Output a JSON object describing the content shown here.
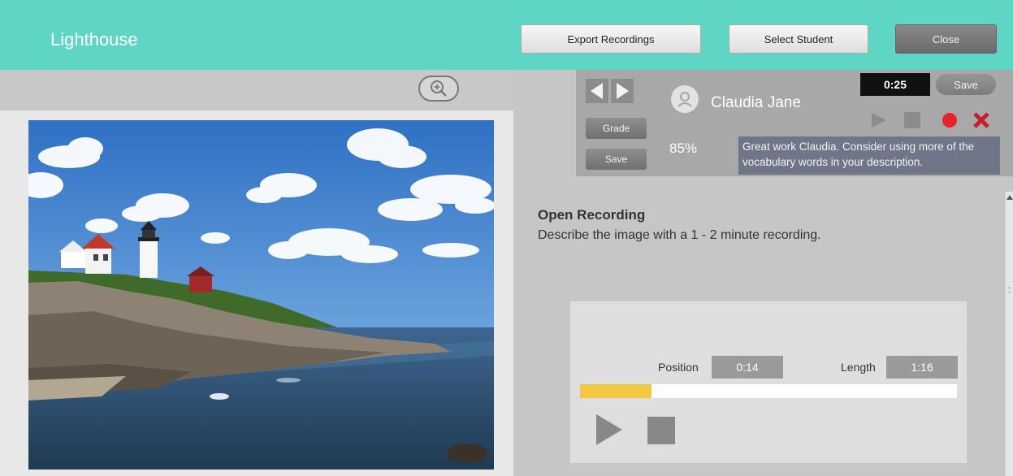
{
  "header": {
    "app_title": "Lighthouse",
    "export_label": "Export Recordings",
    "select_student_label": "Select Student",
    "close_label": "Close",
    "background_color": "#5fd6c3"
  },
  "image_panel": {
    "zoom_icon": "zoom-in-icon",
    "image_description_icon": "lighthouse-photo"
  },
  "grading": {
    "student_name": "Claudia Jane",
    "timer": "0:25",
    "save_label": "Save",
    "grade_label": "Grade",
    "panel_save_label": "Save",
    "score": "85%",
    "comment": "Great work Claudia.  Consider using more of the vocabulary words in your description.",
    "record_color": "#e8212e",
    "delete_color": "#c3222a"
  },
  "activity": {
    "title": "Open Recording",
    "description": "Describe the image with a 1 - 2 minute recording."
  },
  "player": {
    "position_label": "Position",
    "position_value": "0:14",
    "length_label": "Length",
    "length_value": "1:16",
    "progress_fraction": 0.19,
    "progress_color": "#f4c742"
  }
}
